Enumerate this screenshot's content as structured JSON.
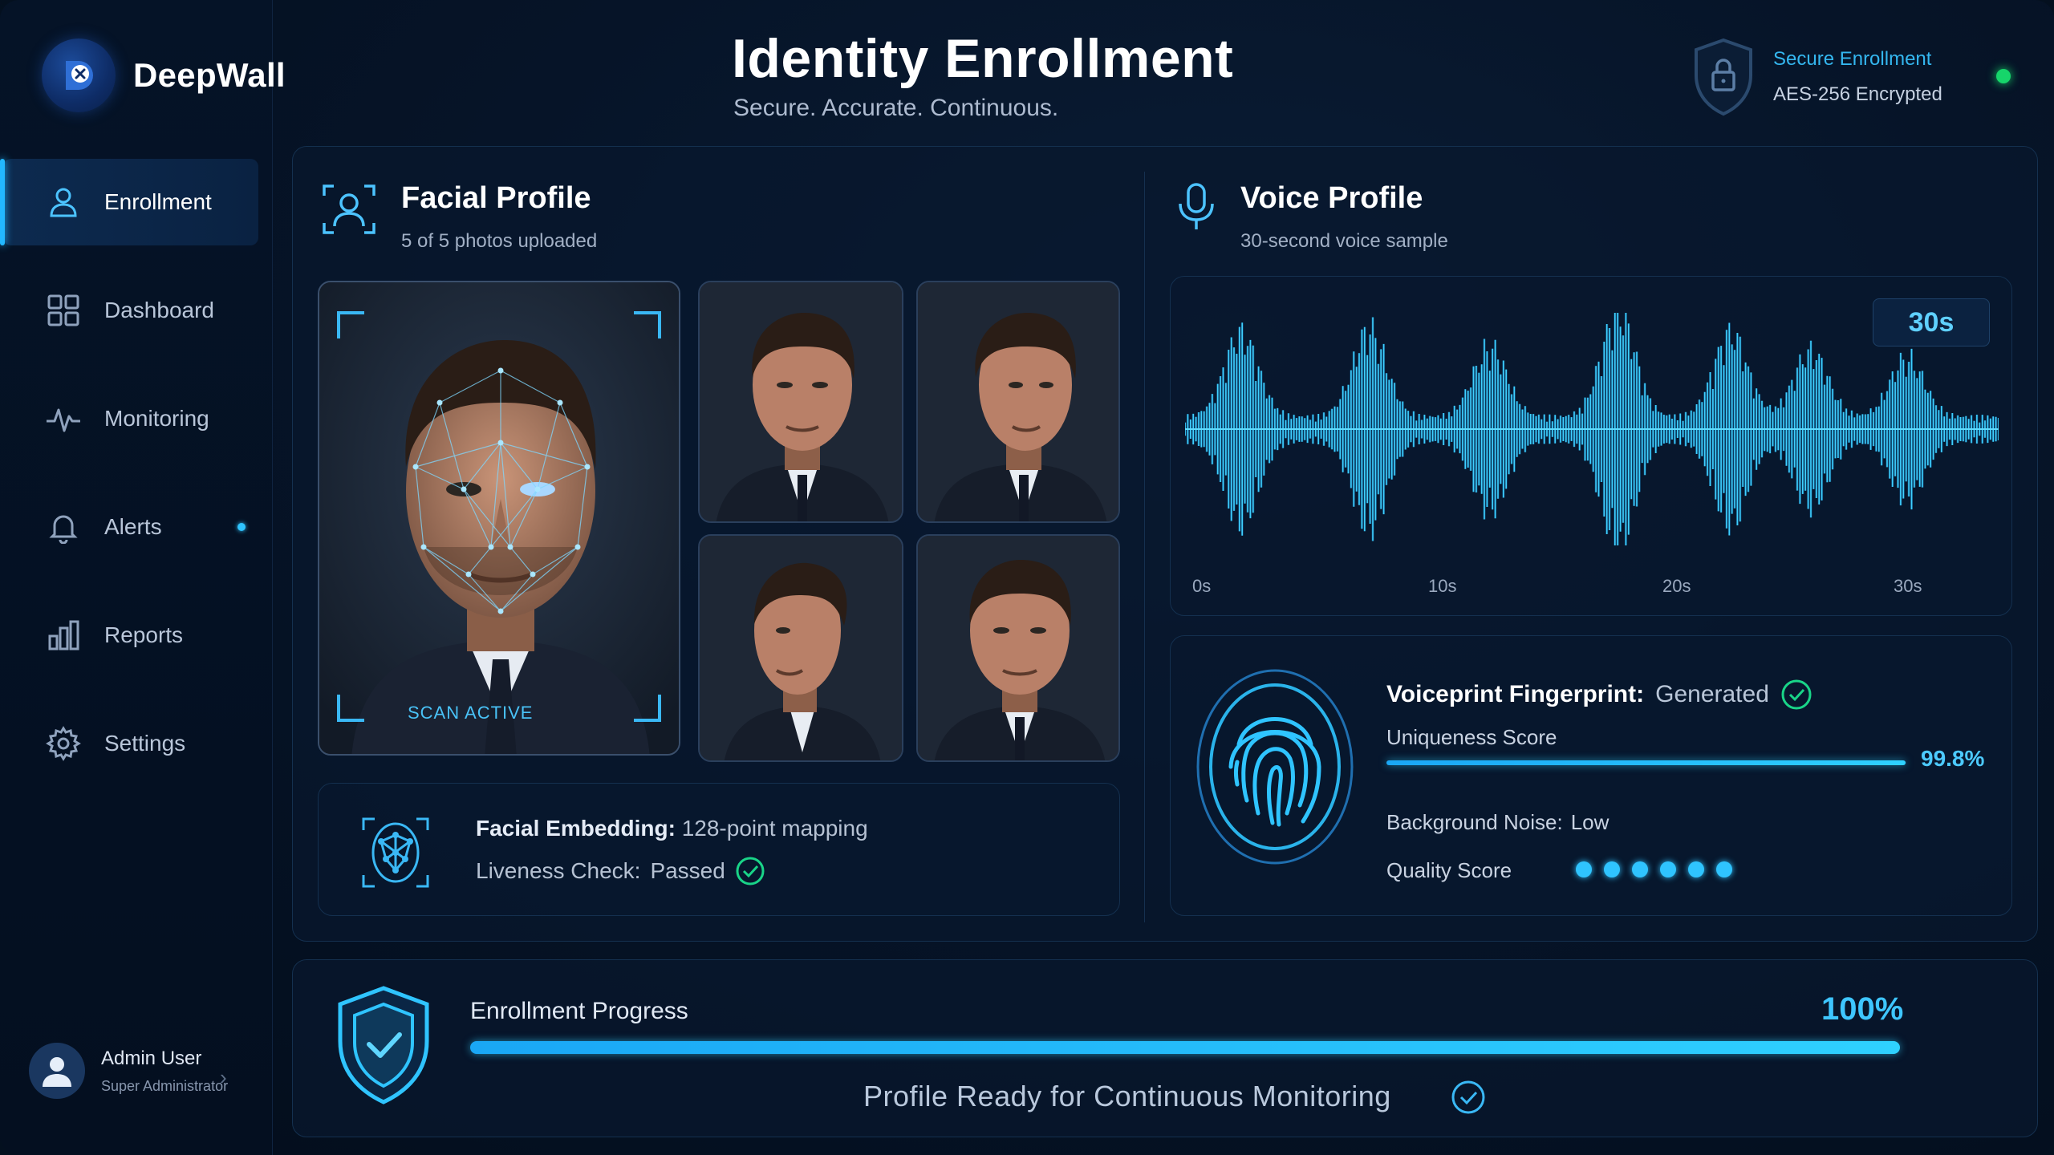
{
  "brand": {
    "name": "DeepWall"
  },
  "header": {
    "title": "Identity Enrollment",
    "subtitle": "Secure. Accurate. Continuous.",
    "secure_title": "Secure Enrollment",
    "secure_sub": "AES-256 Encrypted"
  },
  "sidebar": {
    "items": [
      {
        "label": "Enrollment",
        "icon": "user-icon"
      },
      {
        "label": "Dashboard",
        "icon": "grid-icon"
      },
      {
        "label": "Monitoring",
        "icon": "pulse-icon"
      },
      {
        "label": "Alerts",
        "icon": "bell-icon"
      },
      {
        "label": "Reports",
        "icon": "bar-chart-icon"
      },
      {
        "label": "Settings",
        "icon": "gear-icon"
      }
    ],
    "user_name": "Admin User",
    "user_role": "Super Administrator"
  },
  "facial": {
    "title": "Facial Profile",
    "sub": "5 of 5 photos uploaded",
    "scan_label": "SCAN ACTIVE",
    "embedding_key": "Facial Embedding:",
    "embedding_val": "128-point mapping",
    "liveness_key": "Liveness Check:",
    "liveness_val": "Passed"
  },
  "voice": {
    "title": "Voice Profile",
    "sub": "30-second voice sample",
    "duration": "30s",
    "ticks": [
      "0s",
      "10s",
      "20s",
      "30s"
    ],
    "fingerprint_key": "Voiceprint Fingerprint:",
    "fingerprint_val": "Generated",
    "uniqueness_label": "Uniqueness Score",
    "uniqueness_pct": "99.8%",
    "uniqueness_value": 0.998,
    "noise_key": "Background Noise:",
    "noise_val": "Low",
    "quality_label": "Quality Score",
    "quality_dots": 6
  },
  "progress": {
    "label": "Enrollment Progress",
    "pct": "100%",
    "value": 1.0,
    "status": "Profile Ready for Continuous Monitoring"
  },
  "colors": {
    "accent": "#2fc4ff",
    "success": "#16d56a",
    "background": "#061428"
  }
}
